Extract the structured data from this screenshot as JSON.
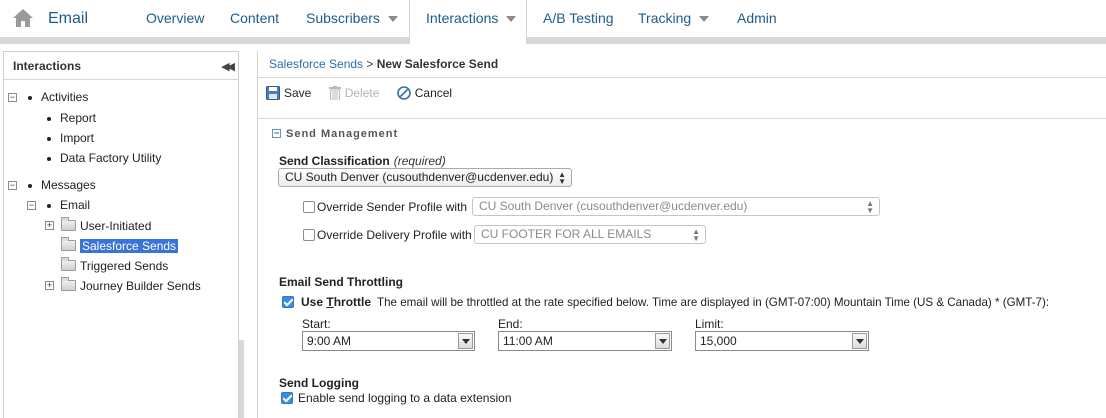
{
  "nav": {
    "home_icon": "home-icon",
    "app_title": "Email",
    "tabs": [
      {
        "label": "Overview",
        "dropdown": false
      },
      {
        "label": "Content",
        "dropdown": false
      },
      {
        "label": "Subscribers",
        "dropdown": true
      },
      {
        "label": "Interactions",
        "dropdown": true,
        "active": true
      },
      {
        "label": "A/B Testing",
        "dropdown": false
      },
      {
        "label": "Tracking",
        "dropdown": true
      },
      {
        "label": "Admin",
        "dropdown": false
      }
    ]
  },
  "sidebar": {
    "title": "Interactions",
    "collapse_icon": "double-chevron-left-icon",
    "tree": {
      "activities": {
        "label": "Activities",
        "expanded": true,
        "children": [
          "Report",
          "Import",
          "Data Factory Utility"
        ]
      },
      "messages": {
        "label": "Messages",
        "expanded": true
      },
      "email": {
        "label": "Email",
        "expanded": true
      },
      "folders": [
        {
          "label": "User-Initiated",
          "expandable": true,
          "selected": false
        },
        {
          "label": "Salesforce Sends",
          "expandable": false,
          "selected": true
        },
        {
          "label": "Triggered Sends",
          "expandable": false,
          "selected": false
        },
        {
          "label": "Journey Builder Sends",
          "expandable": true,
          "selected": false
        }
      ]
    }
  },
  "main": {
    "breadcrumb": {
      "parent": "Salesforce Sends",
      "separator": ">",
      "current": "New Salesforce Send"
    },
    "toolbar": {
      "save": "Save",
      "delete": "Delete",
      "cancel": "Cancel"
    },
    "section_title": "Send Management",
    "send_classification": {
      "label": "Send Classification",
      "required": "(required)",
      "value": "CU South Denver (cusouthdenver@ucdenver.edu)",
      "override_sender": {
        "label": "Override Sender Profile with",
        "checked": false,
        "value": "CU South Denver (cusouthdenver@ucdenver.edu)"
      },
      "override_delivery": {
        "label": "Override Delivery Profile with",
        "checked": false,
        "value": "CU FOOTER FOR ALL EMAILS"
      }
    },
    "throttling": {
      "heading": "Email Send Throttling",
      "use_label_prefix": "Use ",
      "use_label_underline": "T",
      "use_label_suffix": "hrottle",
      "checked": true,
      "description": "The email will be throttled at the rate specified below. Time are displayed in (GMT-07:00) Mountain Time (US & Canada) * (GMT-7):",
      "start": {
        "label": "Start:",
        "value": "9:00 AM"
      },
      "end": {
        "label": "End:",
        "value": "11:00 AM"
      },
      "limit": {
        "label": "Limit:",
        "value": "15,000"
      }
    },
    "logging": {
      "heading": "Send Logging",
      "checked": true,
      "label": "Enable send logging to a data extension"
    }
  },
  "colors": {
    "link": "#1b5e8e",
    "selection": "#3875d7",
    "checkbox": "#3b8de0"
  }
}
